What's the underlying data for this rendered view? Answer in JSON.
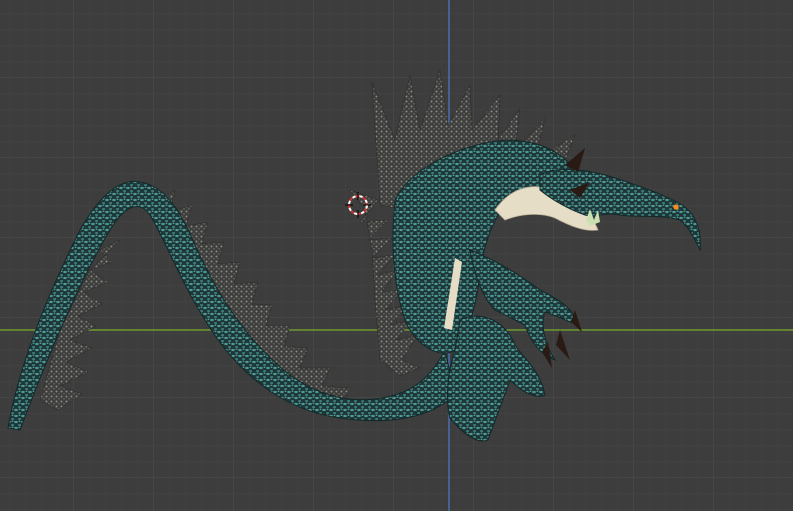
{
  "viewport": {
    "background_color": "#3d3d3d",
    "grid": {
      "visible": true,
      "minor_color": "#444444",
      "major_color": "#4a4a4a"
    },
    "axes": {
      "x_axis_color": "#6e9b2e",
      "z_axis_color": "#4a6fb0"
    },
    "cursor_3d": {
      "icon": "3d-cursor-icon",
      "colors": [
        "#cc3333",
        "#ffffff"
      ]
    },
    "object": {
      "name": "dragon-model",
      "skin_color": "#1f3b3c",
      "skin_highlight": "#4f9a96",
      "spike_color": "#5a5a58",
      "belly_color": "#e6ddc6",
      "eye_color": "#ff8a1c",
      "claw_color": "#2a1a14"
    }
  }
}
